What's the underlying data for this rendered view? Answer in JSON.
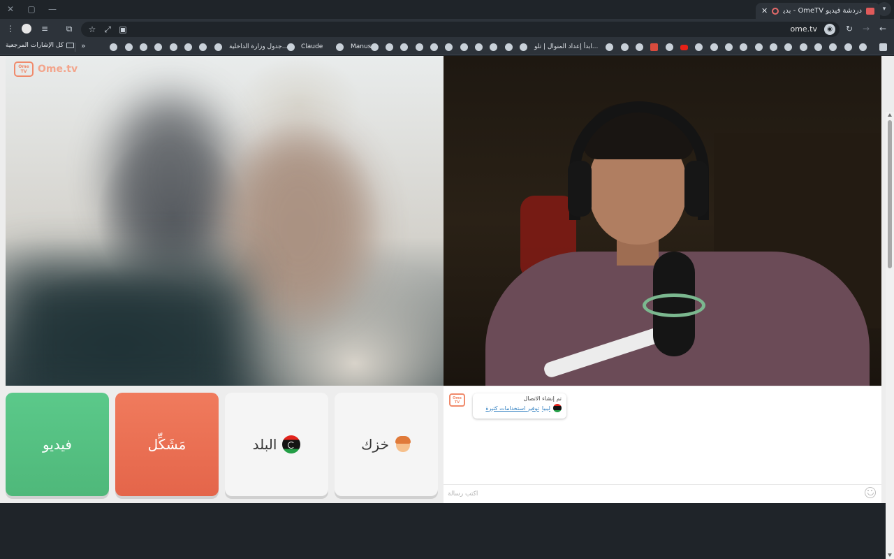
{
  "browser": {
    "tab": {
      "title": "دردشة فيديو OmeTV - بديل",
      "close": "✕"
    },
    "new_tab": "+",
    "window_controls": {
      "minimize": "—",
      "maximize": "▢",
      "close": "✕"
    },
    "address": {
      "url": "ome.tv"
    },
    "bookmarks": {
      "all_bookmarks": "كل الإشارات المرجعية",
      "more": "»",
      "items": [
        {
          "label": "جدول وزارة الداخلية..."
        },
        {
          "label": "Claude"
        },
        {
          "label": "Manus"
        },
        {
          "label": "ابدأ إعداد المنوال | تلو..."
        }
      ]
    }
  },
  "app": {
    "logo_text": "Ome.tv",
    "logo_icon_text": "Ome TV",
    "buttons": {
      "video": "فيديو",
      "report": "مَشَكِّل",
      "country": "البلد",
      "gender": "خزك"
    },
    "chat": {
      "system_message": "تم إنشاء الاتصال",
      "country_link": "ليبيا",
      "promo_link": "توفير استخدامات كثيرة",
      "input_placeholder": "اكتب رسالة",
      "input_value": ""
    }
  },
  "colors": {
    "brand": "#f08a6b",
    "video_button": "#5bc98a",
    "report_button": "#e4654a",
    "link": "#2f7fc1"
  }
}
